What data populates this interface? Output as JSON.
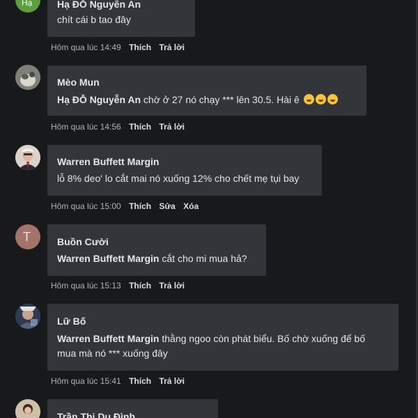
{
  "comments": [
    {
      "author": "Hạ ĐỖ Nguyễn An",
      "avatar_letter": "Hạ",
      "avatar_color": "#5a9f3b",
      "text": "chít cái b tao đây",
      "mention": "",
      "time": "Hôm qua lúc 14:49",
      "actions": [
        "Thích",
        "Trả lời"
      ]
    },
    {
      "author": "Mèo Mun",
      "avatar_color": "#8a8b82",
      "mention": "Hạ ĐỖ Nguyễn An",
      "text": " chờ ở 27 nó chạy *** lên 30.5. Hài ê",
      "emoji_count": 3,
      "emoji_name": "rolling-on-floor-laughing",
      "time": "Hôm qua lúc 14:56",
      "actions": [
        "Thích",
        "Trả lời"
      ]
    },
    {
      "author": "Warren Buffett Margin",
      "avatar_color": "#c9c3b7",
      "mention": "",
      "text": "lỗ 8% deo' lo cắt mai nó xuống 12% cho chết mẹ tụi bay",
      "time": "Hôm qua lúc 15:00",
      "actions": [
        "Thích",
        "Sửa",
        "Xóa"
      ]
    },
    {
      "author": "Buồn Cười",
      "avatar_letter": "T",
      "avatar_color": "#a4736a",
      "mention": "Warren Buffett Margin",
      "text": " cắt cho mi mua hả?",
      "time": "Hôm qua lúc 15:13",
      "actions": [
        "Thích",
        "Trả lời"
      ]
    },
    {
      "author": "Lữ Bố",
      "avatar_color": "#3c4a63",
      "mention": "Warren Buffett Margin",
      "text": " thằng ngoo còn phát biểu. Bố chờ xuống để bố",
      "text_line2": "mua mà nó *** xuống đây",
      "time": "Hôm qua lúc 15:41",
      "actions": [
        "Thích",
        "Trả lời"
      ]
    },
    {
      "author": "Trần Thị Du Đình",
      "avatar_color": "#c7b8a4"
    }
  ]
}
